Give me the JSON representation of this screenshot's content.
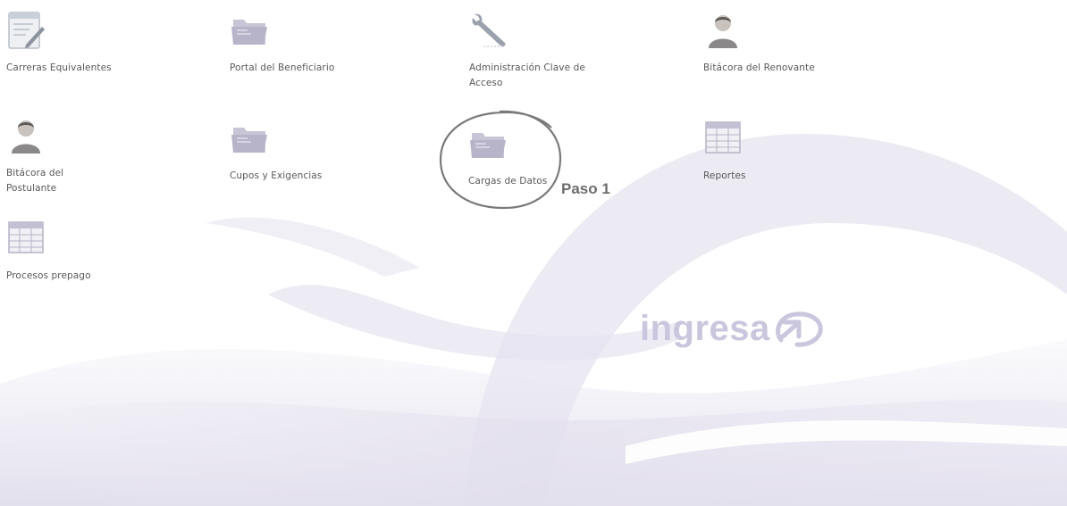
{
  "menu": {
    "items": [
      {
        "label": "Carreras Equivalentes",
        "icon": "edit-document-icon"
      },
      {
        "label": "Portal del Beneficiario",
        "icon": "folder-icon"
      },
      {
        "label": "Administración Clave de Acceso",
        "icon": "wrench-icon"
      },
      {
        "label": "Bitácora del Renovante",
        "icon": "user-icon"
      },
      {
        "label": "Bitácora del Postulante",
        "icon": "user-icon"
      },
      {
        "label": "Cupos y Exigencias",
        "icon": "folder-icon"
      },
      {
        "label": "Cargas de Datos",
        "icon": "folder-icon"
      },
      {
        "label": "Reportes",
        "icon": "table-grid-icon"
      },
      {
        "label": "Procesos prepago",
        "icon": "table-grid-icon"
      }
    ]
  },
  "annotation": {
    "step_label": "Paso 1"
  },
  "brand": {
    "logo_text": "ingresa"
  },
  "colors": {
    "background": "#ffffff",
    "watermark": "#e6e3f0",
    "logo": "#c9c6dd",
    "label_text": "#585858",
    "circle_annotation": "#777777"
  }
}
